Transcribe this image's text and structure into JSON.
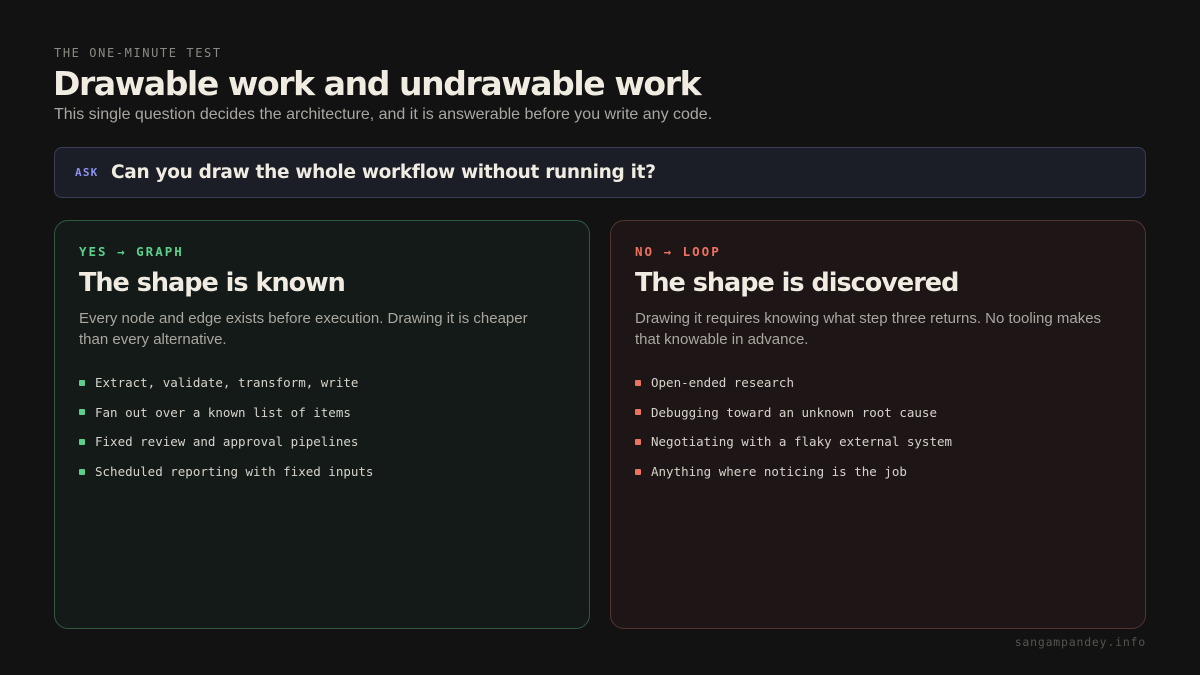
{
  "header": {
    "eyebrow": "THE ONE-MINUTE TEST",
    "title": "Drawable work and undrawable work",
    "subtitle": "This single question decides the architecture, and it is answerable before you write any code."
  },
  "ask": {
    "tag": "ASK",
    "question": "Can you draw the whole workflow without running it?"
  },
  "cards": {
    "yes": {
      "tag": "YES → GRAPH",
      "title": "The shape is known",
      "description": "Every node and edge exists before execution. Drawing it is cheaper than every alternative.",
      "accent": "#5ccf8c",
      "items": [
        "Extract, validate, transform, write",
        "Fan out over a known list of items",
        "Fixed review and approval pipelines",
        "Scheduled reporting with fixed inputs"
      ]
    },
    "no": {
      "tag": "NO → LOOP",
      "title": "The shape is discovered",
      "description": "Drawing it requires knowing what step three returns. No tooling makes that knowable in advance.",
      "accent": "#ee7260",
      "items": [
        "Open-ended research",
        "Debugging toward an unknown root cause",
        "Negotiating with a flaky external system",
        "Anything where noticing is the job"
      ]
    }
  },
  "footer": {
    "site": "sangampandey.info"
  }
}
